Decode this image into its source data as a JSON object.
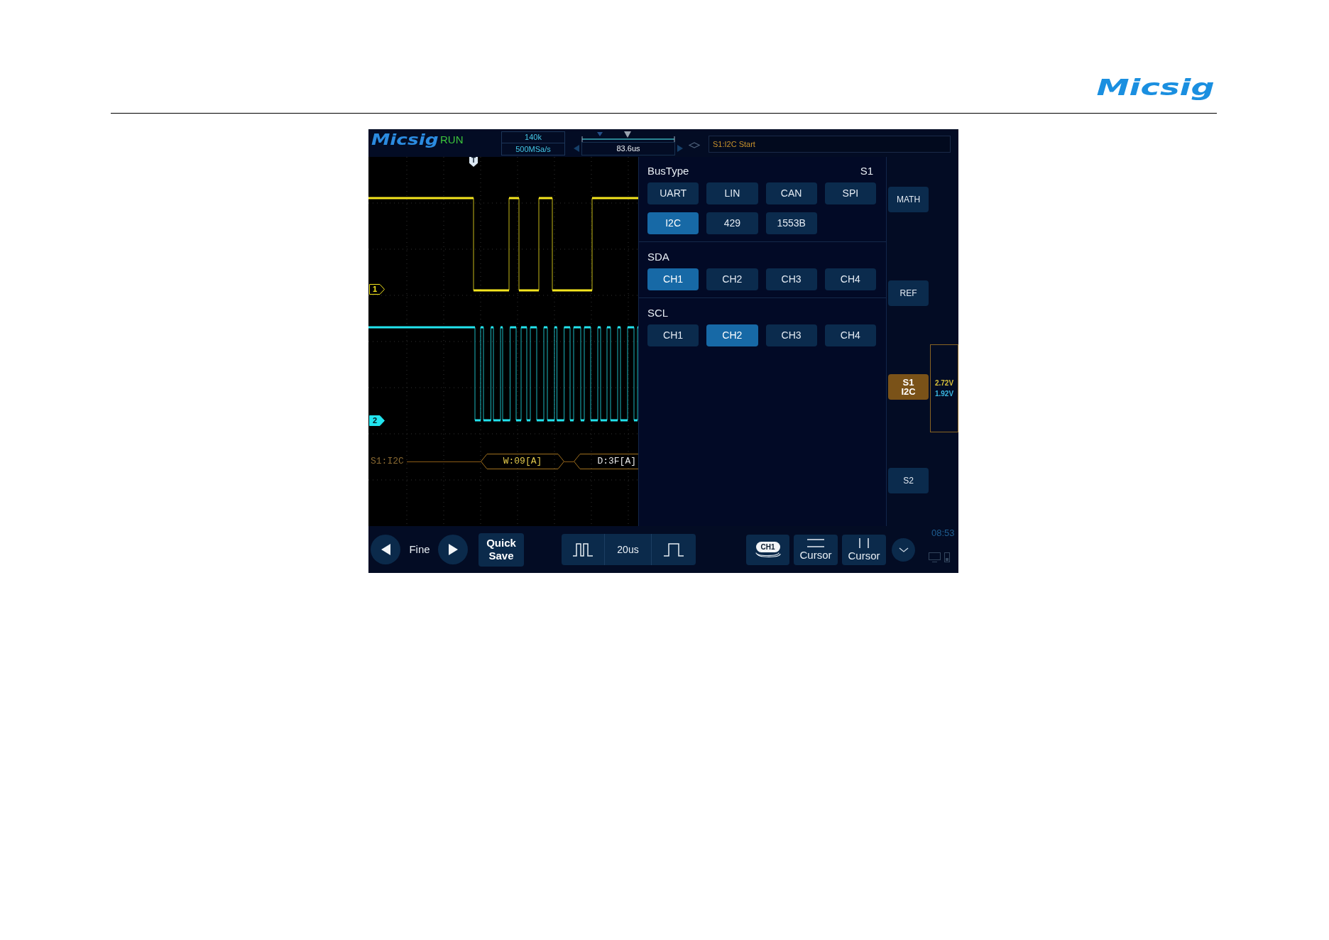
{
  "header": {
    "logo": "Micsig"
  },
  "scope": {
    "top_bar": {
      "logo": "Micsig",
      "run_state": "RUN",
      "memory_depth": "140k",
      "sample_rate": "500MSa/s",
      "time_offset": "83.6us",
      "trigger_info": "S1:I2C Start"
    },
    "waveform": {
      "trigger_marker": "T",
      "channels": [
        {
          "label": "1",
          "color": "#f5e61e",
          "selected": false
        },
        {
          "label": "2",
          "color": "#22e4ee",
          "selected": true
        }
      ],
      "bus_decode": {
        "label": "S1:I2C",
        "packets": [
          {
            "text": "W:09[A]",
            "color": "#e2c94c",
            "clipped": false
          },
          {
            "text": "D:3F[A]",
            "color": "#e8e8e8",
            "clipped": true
          }
        ]
      }
    },
    "bus_menu": {
      "slot": "S1",
      "groups": [
        {
          "title": "BusType",
          "options": [
            {
              "label": "UART",
              "selected": false
            },
            {
              "label": "LIN",
              "selected": false
            },
            {
              "label": "CAN",
              "selected": false
            },
            {
              "label": "SPI",
              "selected": false
            },
            {
              "label": "I2C",
              "selected": true
            },
            {
              "label": "429",
              "selected": false
            },
            {
              "label": "1553B",
              "selected": false
            }
          ]
        },
        {
          "title": "SDA",
          "options": [
            {
              "label": "CH1",
              "selected": true
            },
            {
              "label": "CH2",
              "selected": false
            },
            {
              "label": "CH3",
              "selected": false
            },
            {
              "label": "CH4",
              "selected": false
            }
          ]
        },
        {
          "title": "SCL",
          "options": [
            {
              "label": "CH1",
              "selected": false
            },
            {
              "label": "CH2",
              "selected": true
            },
            {
              "label": "CH3",
              "selected": false
            },
            {
              "label": "CH4",
              "selected": false
            }
          ]
        }
      ]
    },
    "side_buttons": [
      {
        "label": "MATH",
        "selected": false
      },
      {
        "label": "REF",
        "selected": false
      },
      {
        "label": "S1",
        "sublabel": "I2C",
        "selected": true
      },
      {
        "label": "S2",
        "selected": false
      }
    ],
    "trigger_levels": [
      {
        "text": "2.72V",
        "color": "#d8c03c"
      },
      {
        "text": "1.92V",
        "color": "#3ab6e0"
      }
    ],
    "bottom_bar": {
      "adjust_mode": "Fine",
      "quick_save": "Quick Save",
      "timebase": "20us",
      "channel_button": "CH1",
      "cursors": [
        {
          "label": "Cursor",
          "kind": "horizontal"
        },
        {
          "label": "Cursor",
          "kind": "vertical"
        }
      ],
      "clock": "08:53"
    }
  }
}
